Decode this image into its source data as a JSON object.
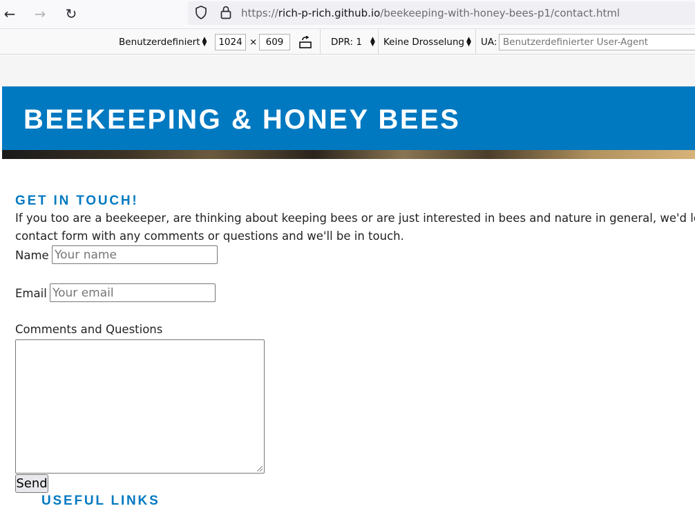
{
  "browser": {
    "url_prefix": "https://",
    "url_host": "rich-p-rich.github.io",
    "url_path": "/beekeeping-with-honey-bees-p1/contact.html"
  },
  "rdm_toolbar": {
    "device": "Benutzerdefiniert",
    "width": "1024",
    "times": "×",
    "height": "609",
    "dpr": "DPR: 1",
    "throttling": "Keine Drosselung",
    "ua_label": "UA:",
    "ua_placeholder": "Benutzerdefinierter User-Agent"
  },
  "site": {
    "title": "BEEKEEPING & HONEY BEES",
    "contact": {
      "heading": "GET IN TOUCH!",
      "intro_line1": "If you too are a beekeeper, are thinking about keeping bees or are just interested in bees and nature in general, we'd love",
      "intro_line2": "contact form with any comments or questions and we'll be in touch.",
      "name_label": "Name",
      "name_placeholder": "Your name",
      "email_label": "Email",
      "email_placeholder": "Your email",
      "comments_label": "Comments and Questions",
      "send_label": "Send"
    },
    "links": {
      "heading": "USEFUL LINKS"
    }
  },
  "colors": {
    "brand_blue": "#0079c1"
  }
}
